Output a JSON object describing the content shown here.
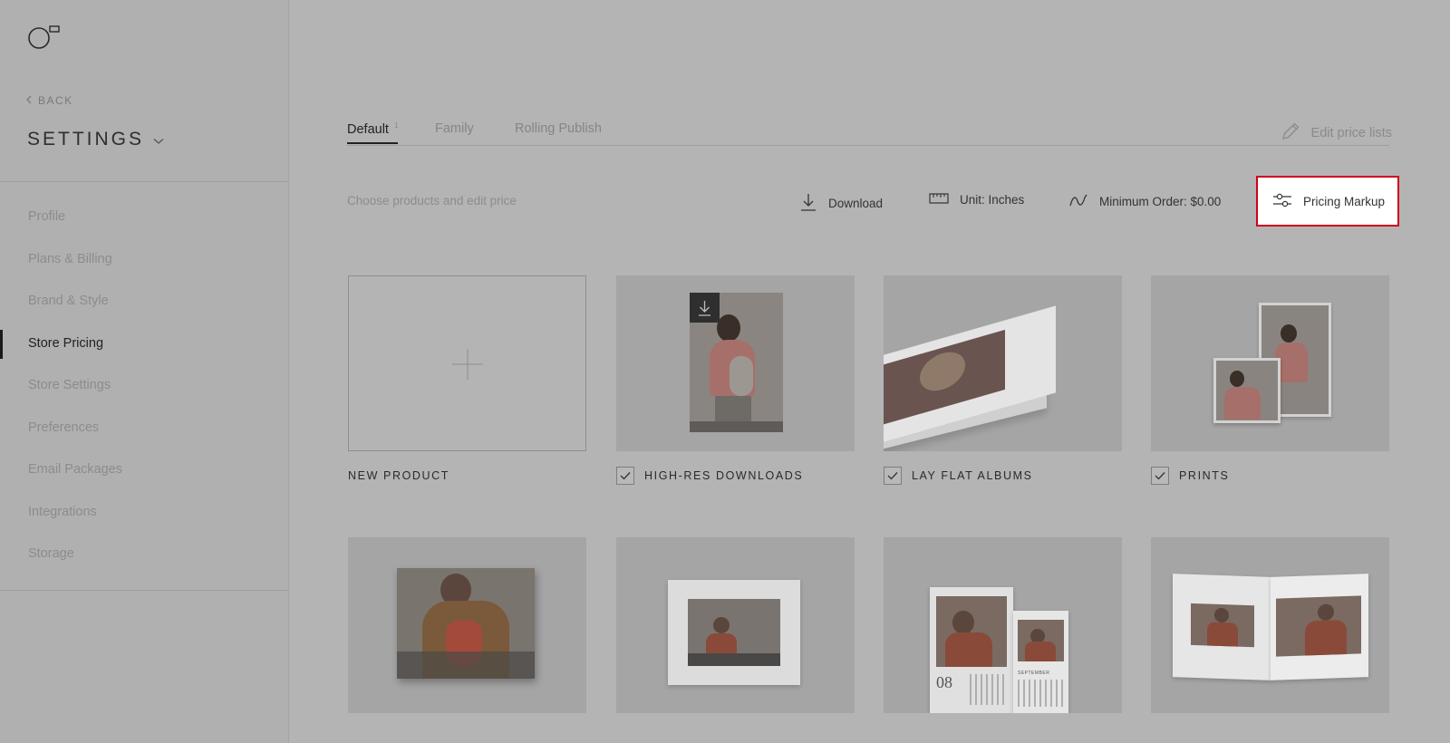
{
  "sidebar": {
    "back_label": "BACK",
    "title": "SETTINGS",
    "items": [
      {
        "label": "Profile"
      },
      {
        "label": "Plans & Billing"
      },
      {
        "label": "Brand & Style"
      },
      {
        "label": "Store Pricing",
        "active": true
      },
      {
        "label": "Store Settings"
      },
      {
        "label": "Preferences"
      },
      {
        "label": "Email Packages"
      },
      {
        "label": "Integrations"
      },
      {
        "label": "Storage"
      }
    ]
  },
  "tabs": [
    {
      "label": "Default",
      "active": true,
      "badge": "1"
    },
    {
      "label": "Family"
    },
    {
      "label": "Rolling Publish"
    }
  ],
  "edit_price_lists": "Edit price lists",
  "toolbar": {
    "hint": "Choose products and edit price",
    "download": "Download",
    "unit": "Unit: Inches",
    "minimum_order": "Minimum Order: $0.00",
    "pricing_markup": "Pricing Markup"
  },
  "products": [
    {
      "label": "NEW PRODUCT",
      "checked": false
    },
    {
      "label": "HIGH-RES DOWNLOADS",
      "checked": true
    },
    {
      "label": "LAY FLAT ALBUMS",
      "checked": true
    },
    {
      "label": "PRINTS",
      "checked": true
    }
  ],
  "calendar_text": {
    "day": "08",
    "month": "SEPTEMBER"
  },
  "colors": {
    "accent_highlight": "#d0021b",
    "overlay": "#b4b4b4"
  }
}
